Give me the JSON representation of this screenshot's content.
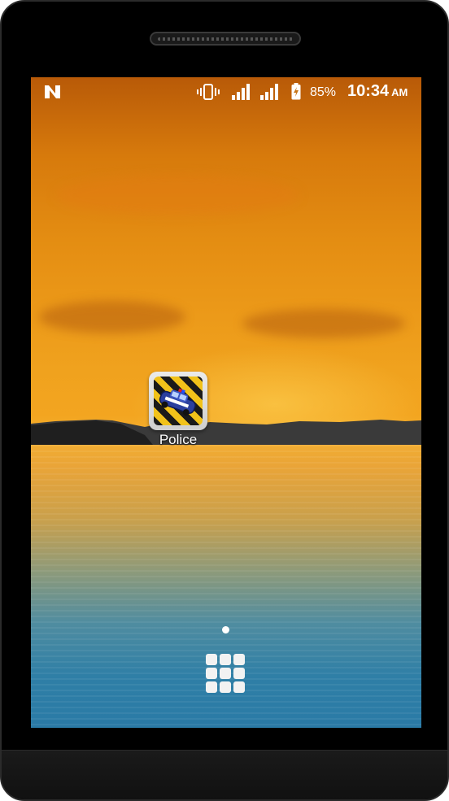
{
  "status_bar": {
    "notification_icon": "n-icon",
    "vibrate_icon": "vibrate-icon",
    "signal_icons": [
      "signal-icon-sim1",
      "signal-icon-sim2"
    ],
    "battery_icon": "battery-charging-icon",
    "battery_percent": "85%",
    "time": "10:34",
    "ampm": "AM"
  },
  "home_screen": {
    "apps": [
      {
        "label": "Police",
        "icon": "police-car-icon"
      }
    ],
    "page_indicator": {
      "pages": 1,
      "current": 1
    },
    "app_drawer_icon": "app-drawer-grid-icon"
  },
  "colors": {
    "sky_top": "#b85a08",
    "horizon": "#f3a520",
    "sea_bottom": "#2a7aa6",
    "device_frame": "#000000"
  }
}
